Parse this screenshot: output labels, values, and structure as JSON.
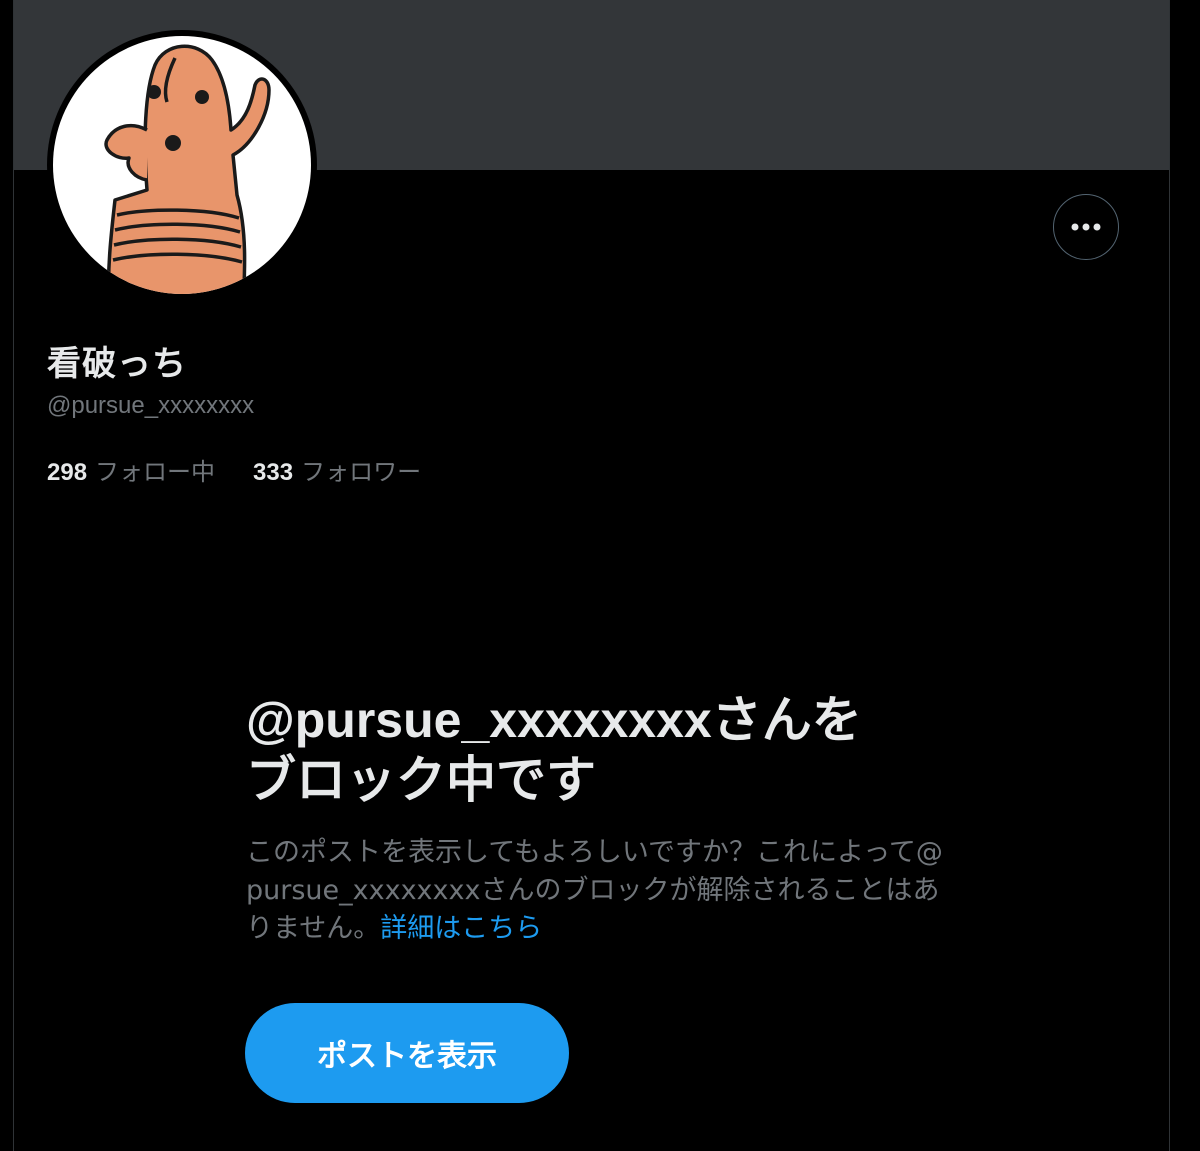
{
  "profile": {
    "display_name": "看破っち",
    "handle": "@pursue_xxxxxxxx",
    "following_count": "298",
    "following_label": "フォロー中",
    "followers_count": "333",
    "followers_label": "フォロワー",
    "avatar_icon": "haniwa-character-avatar"
  },
  "header": {
    "more_icon": "more-dots-icon"
  },
  "block_notice": {
    "title": "@pursue_xxxxxxxxさんをブロック中です",
    "description": "このポストを表示してもよろしいですか？これによって@pursue_xxxxxxxxさんのブロックが解除されることはありません。",
    "learn_more": "詳細はこちら",
    "view_button": "ポストを表示"
  },
  "colors": {
    "background": "#000000",
    "banner": "#333639",
    "accent": "#1d9bf0",
    "text_primary": "#e7e9ea",
    "text_secondary": "#71767b",
    "avatar_skin": "#e8956b"
  }
}
